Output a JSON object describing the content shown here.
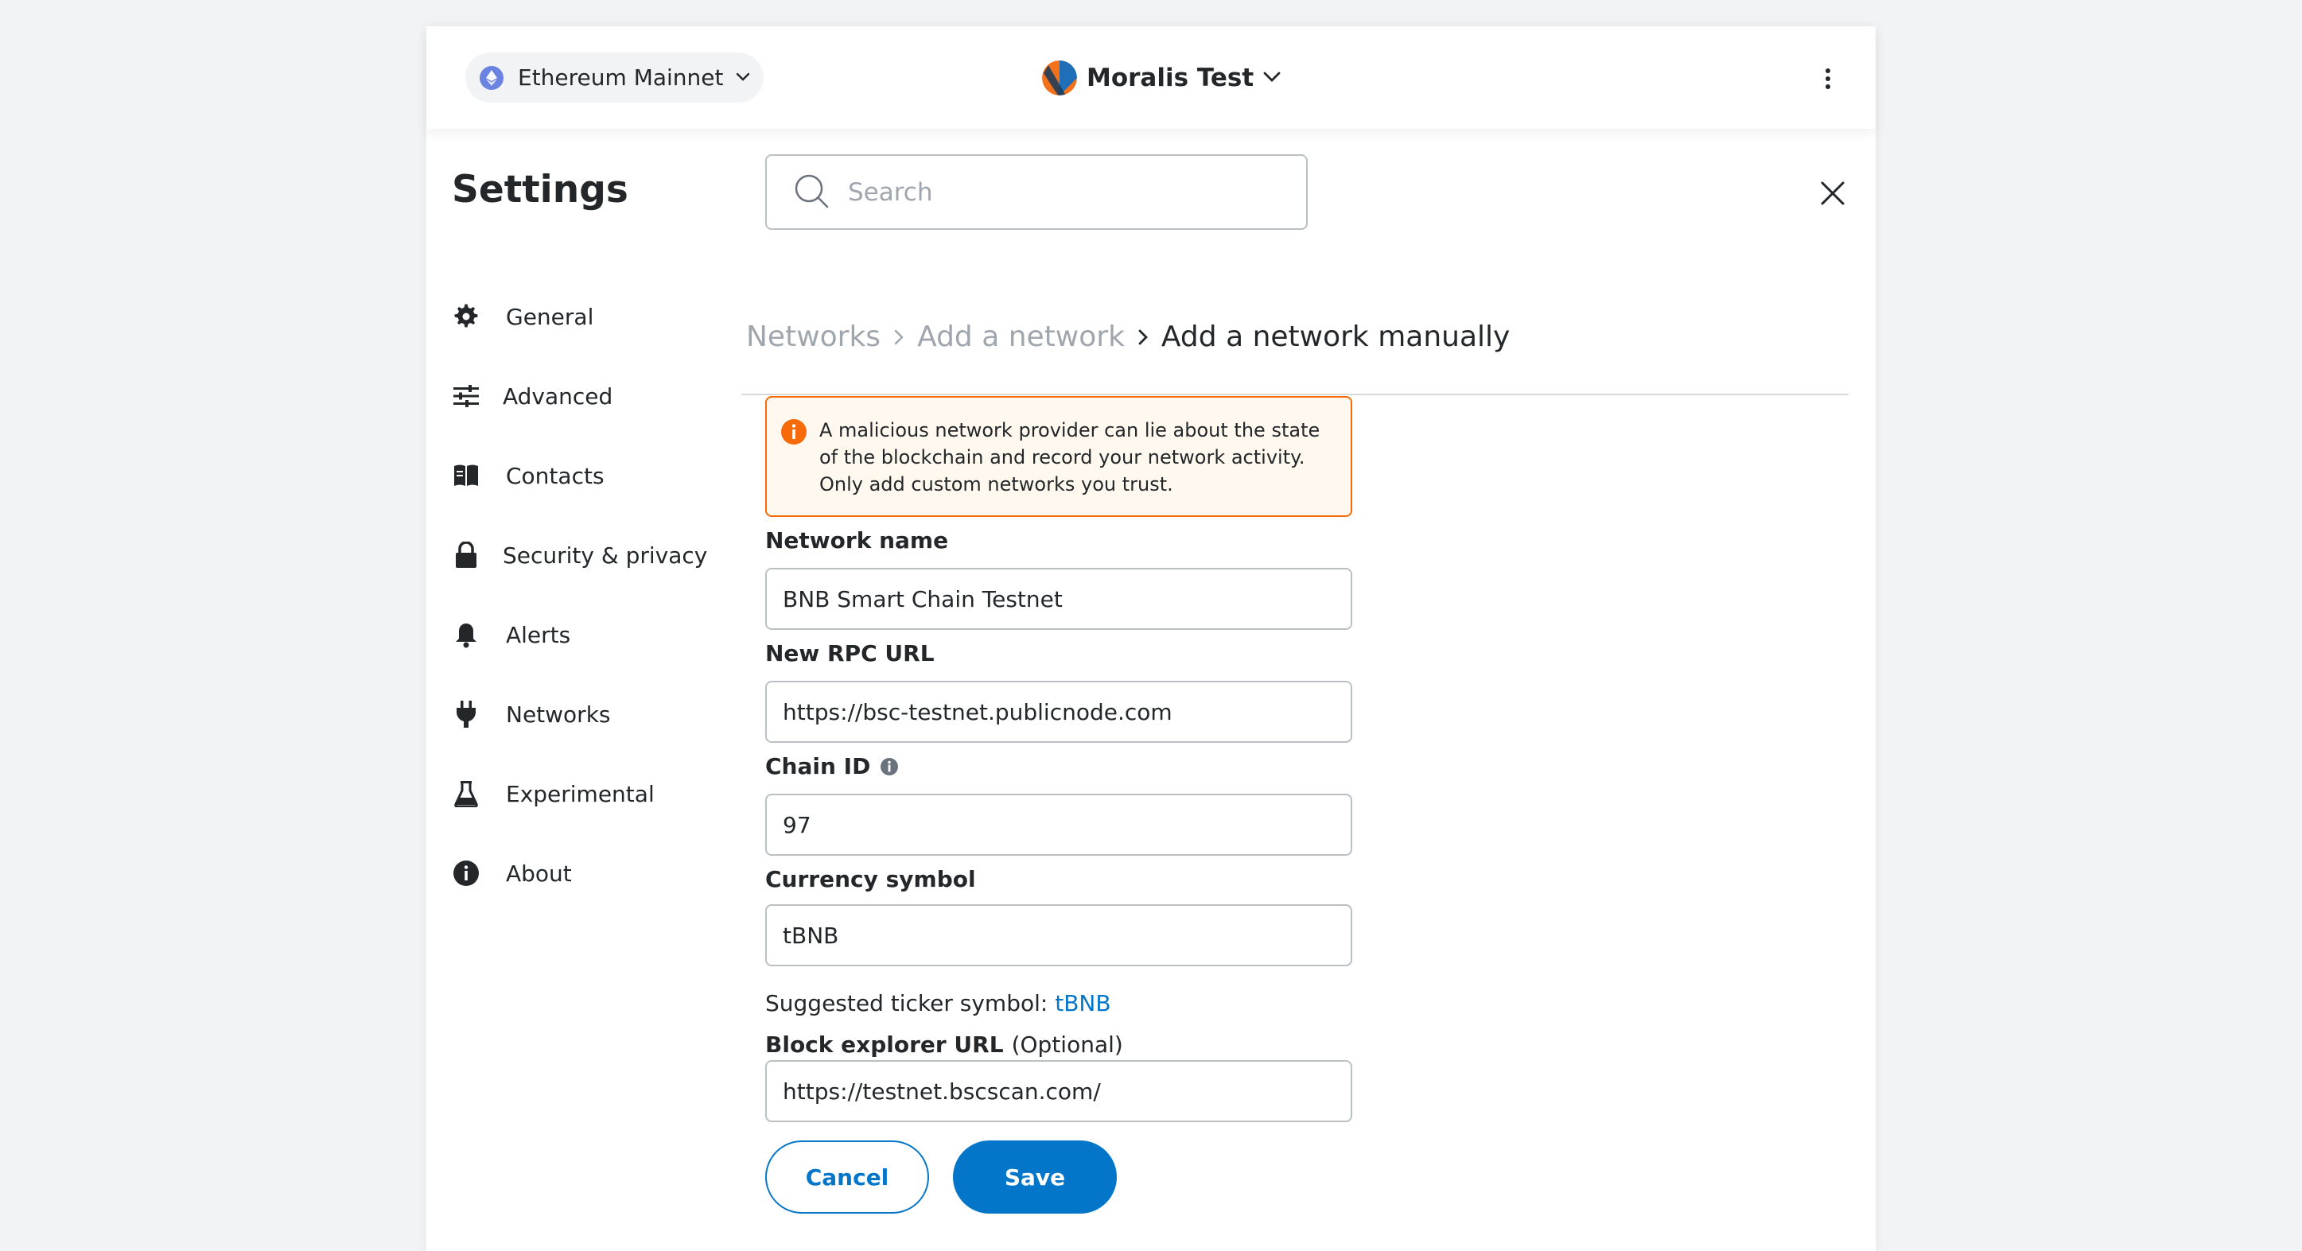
{
  "header": {
    "network": "Ethereum Mainnet",
    "account": "Moralis Test"
  },
  "settings": {
    "title": "Settings",
    "search_placeholder": "Search"
  },
  "sidebar": {
    "items": [
      {
        "label": "General",
        "icon": "gear-icon"
      },
      {
        "label": "Advanced",
        "icon": "sliders-icon"
      },
      {
        "label": "Contacts",
        "icon": "book-icon"
      },
      {
        "label": "Security & privacy",
        "icon": "lock-icon"
      },
      {
        "label": "Alerts",
        "icon": "bell-icon"
      },
      {
        "label": "Networks",
        "icon": "plug-icon"
      },
      {
        "label": "Experimental",
        "icon": "flask-icon"
      },
      {
        "label": "About",
        "icon": "info-icon"
      }
    ]
  },
  "breadcrumb": {
    "networks": "Networks",
    "add_network": "Add a network",
    "current": "Add a network manually"
  },
  "warning": {
    "text": "A malicious network provider can lie about the state of the blockchain and record your network activity. Only add custom networks you trust."
  },
  "form": {
    "network_name_label": "Network name",
    "network_name_value": "BNB Smart Chain Testnet",
    "rpc_url_label": "New RPC URL",
    "rpc_url_value": "https://bsc-testnet.publicnode.com",
    "chain_id_label": "Chain ID",
    "chain_id_value": "97",
    "currency_label": "Currency symbol",
    "currency_value": "tBNB",
    "suggested_prefix": "Suggested ticker symbol:",
    "suggested_value": "tBNB",
    "explorer_label": "Block explorer URL",
    "explorer_optional": "(Optional)",
    "explorer_value": "https://testnet.bscscan.com/"
  },
  "buttons": {
    "cancel": "Cancel",
    "save": "Save"
  },
  "colors": {
    "primary": "#0376c9",
    "warning_border": "#f66a0a",
    "warning_bg": "#fef8ef",
    "muted_text": "#a0a6ad"
  }
}
